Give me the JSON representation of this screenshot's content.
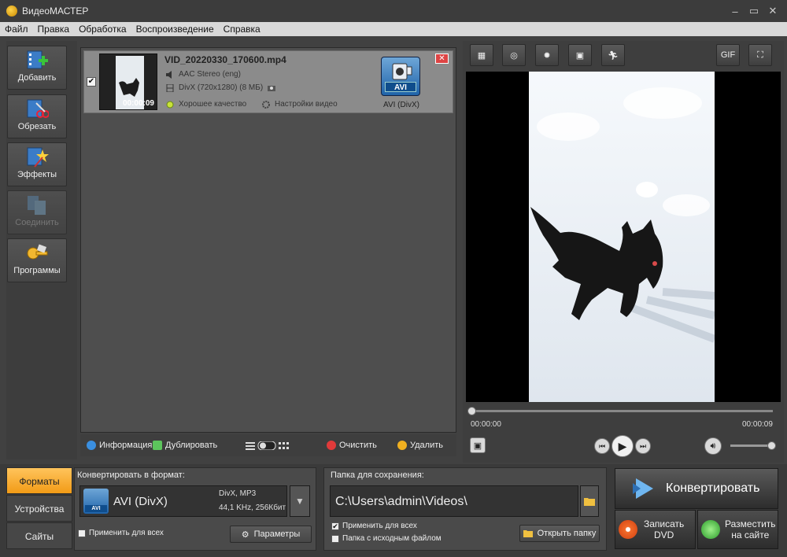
{
  "window": {
    "title": "ВидеоМАСТЕР",
    "min": "–",
    "max": "▭",
    "close": "✕"
  },
  "menu": [
    "Файл",
    "Правка",
    "Обработка",
    "Воспроизведение",
    "Справка"
  ],
  "sidebar": [
    {
      "label": "Добавить",
      "icon": "add-film-icon"
    },
    {
      "label": "Обрезать",
      "icon": "scissors-icon"
    },
    {
      "label": "Эффекты",
      "icon": "effects-icon"
    },
    {
      "label": "Соединить",
      "icon": "join-icon",
      "disabled": true
    },
    {
      "label": "Программы",
      "icon": "programs-icon"
    }
  ],
  "file": {
    "checked": "✔",
    "name": "VID_20220330_170600.mp4",
    "duration": "00:00:09",
    "audio": "AAC Stereo (eng)",
    "video": "DivX (720x1280) (8 МБ)",
    "quality": "Хорошее качество",
    "settings": "Настройки видео",
    "format_badge": "AVI",
    "format_caption": "AVI (DivX)",
    "remove": "✕"
  },
  "filebar": {
    "info": "Информация",
    "duplicate": "Дублировать",
    "clear": "Очистить",
    "delete": "Удалить"
  },
  "preview": {
    "tools": [
      "crop-icon",
      "rotate-icon",
      "brightness-icon",
      "enhance-icon",
      "speed-icon"
    ],
    "gif": "GIF",
    "time_start": "00:00:00",
    "time_end": "00:00:09",
    "progress": 0.0,
    "volume": 0.95
  },
  "tabs": [
    {
      "label": "Форматы",
      "active": true
    },
    {
      "label": "Устройства",
      "active": false
    },
    {
      "label": "Сайты",
      "active": false
    }
  ],
  "format": {
    "caption": "Конвертировать в формат:",
    "name": "AVI (DivX)",
    "badge": "AVI",
    "codec": "DivX, MP3",
    "details": "44,1 KHz, 256Кбит",
    "apply_all": "Применить для всех",
    "params": "Параметры",
    "dropdown": "▼"
  },
  "output": {
    "caption": "Папка для сохранения:",
    "path": "C:\\Users\\admin\\Videos\\",
    "apply_all": "Применить для всех",
    "apply_checked": "✔",
    "source_folder": "Папка с исходным файлом",
    "open_folder": "Открыть папку"
  },
  "actions": {
    "convert": "Конвертировать",
    "dvd_line1": "Записать",
    "dvd_line2": "DVD",
    "web_line1": "Разместить",
    "web_line2": "на сайте"
  },
  "colors": {
    "accent": "#f29b16",
    "panel": "#3e3e3e",
    "file_bg": "#8b8b8b"
  }
}
